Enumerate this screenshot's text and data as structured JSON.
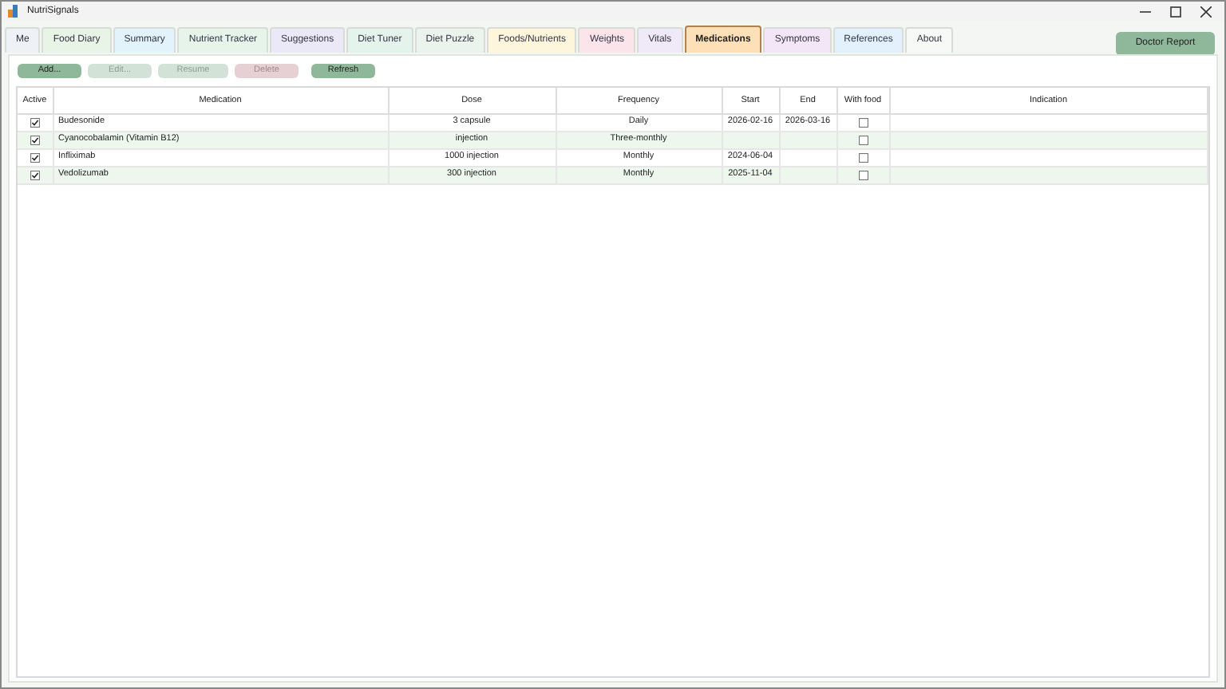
{
  "window": {
    "title": "NutriSignals"
  },
  "tabs": [
    {
      "label": "Me",
      "selected": false,
      "color": "#eef2f7"
    },
    {
      "label": "Food Diary",
      "selected": false,
      "color": "#e8f5e6"
    },
    {
      "label": "Summary",
      "selected": false,
      "color": "#e3f3fb"
    },
    {
      "label": "Nutrient Tracker",
      "selected": false,
      "color": "#e6f4ea"
    },
    {
      "label": "Suggestions",
      "selected": false,
      "color": "#ebe9f7"
    },
    {
      "label": "Diet Tuner",
      "selected": false,
      "color": "#e4f4ec"
    },
    {
      "label": "Diet Puzzle",
      "selected": false,
      "color": "#eaf3ec"
    },
    {
      "label": "Foods/Nutrients",
      "selected": false,
      "color": "#fdf6dc"
    },
    {
      "label": "Weights",
      "selected": false,
      "color": "#fbe4ea"
    },
    {
      "label": "Vitals",
      "selected": false,
      "color": "#efe9f8"
    },
    {
      "label": "Medications",
      "selected": true,
      "color": "#fde0b8"
    },
    {
      "label": "Symptoms",
      "selected": false,
      "color": "#f3e6f6"
    },
    {
      "label": "References",
      "selected": false,
      "color": "#e2f1fb"
    },
    {
      "label": "About",
      "selected": false,
      "color": "#f7f9f7"
    }
  ],
  "report_button": "Doctor Report",
  "toolbar": [
    {
      "label": "Add...",
      "disabled": false,
      "kind": "green"
    },
    {
      "label": "Edit...",
      "disabled": true,
      "kind": "green"
    },
    {
      "label": "Resume",
      "disabled": true,
      "kind": "green"
    },
    {
      "label": "Delete",
      "disabled": true,
      "kind": "red"
    },
    {
      "label": "Refresh",
      "disabled": false,
      "kind": "green"
    }
  ],
  "table": {
    "columns": [
      "Active",
      "Medication",
      "Dose",
      "Frequency",
      "Start",
      "End",
      "With food",
      "Indication"
    ],
    "rows": [
      {
        "active": true,
        "medication": "Budesonide",
        "dose": "3 capsule",
        "frequency": "Daily",
        "start": "2026-02-16",
        "end": "2026-03-16",
        "with_food": false
      },
      {
        "active": true,
        "medication": "Cyanocobalamin (Vitamin B12)",
        "dose": "injection",
        "frequency": "Three-monthly",
        "with_food": false
      },
      {
        "active": true,
        "medication": "Infliximab",
        "dose": "1000 injection",
        "frequency": "Monthly",
        "start": "2024-06-04",
        "with_food": false
      },
      {
        "active": true,
        "medication": "Vedolizumab",
        "dose": "300 injection",
        "frequency": "Monthly",
        "start": "2025-11-04",
        "with_food": false
      }
    ]
  }
}
